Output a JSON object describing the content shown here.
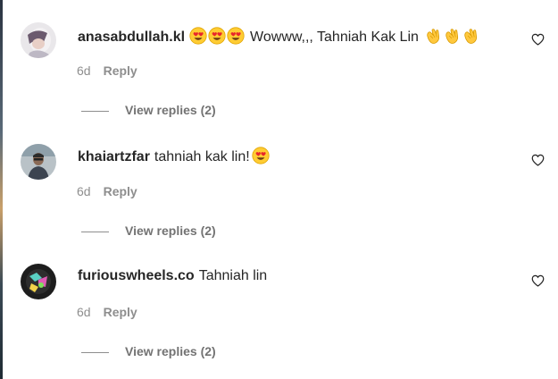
{
  "comments": [
    {
      "username": "anasabdullah.kl",
      "text": "Wowww,,, Tahniah Kak Lin",
      "leading_emojis": [
        "heart-eyes-emoji",
        "heart-eyes-emoji",
        "heart-eyes-emoji"
      ],
      "trailing_emojis": [
        "clapping-hands-emoji",
        "clapping-hands-emoji",
        "clapping-hands-emoji"
      ],
      "time": "6d",
      "reply_label": "Reply",
      "view_replies": "View replies (2)"
    },
    {
      "username": "khaiartzfar",
      "text": "tahniah kak lin!",
      "trailing_emojis": [
        "heart-eyes-emoji"
      ],
      "time": "6d",
      "reply_label": "Reply",
      "view_replies": "View replies (2)"
    },
    {
      "username": "furiouswheels.co",
      "text": "Tahniah lin",
      "time": "6d",
      "reply_label": "Reply",
      "view_replies": "View replies (2)"
    }
  ],
  "colors": {
    "text": "#262626",
    "secondary": "#8e8e8e",
    "background": "#ffffff"
  }
}
